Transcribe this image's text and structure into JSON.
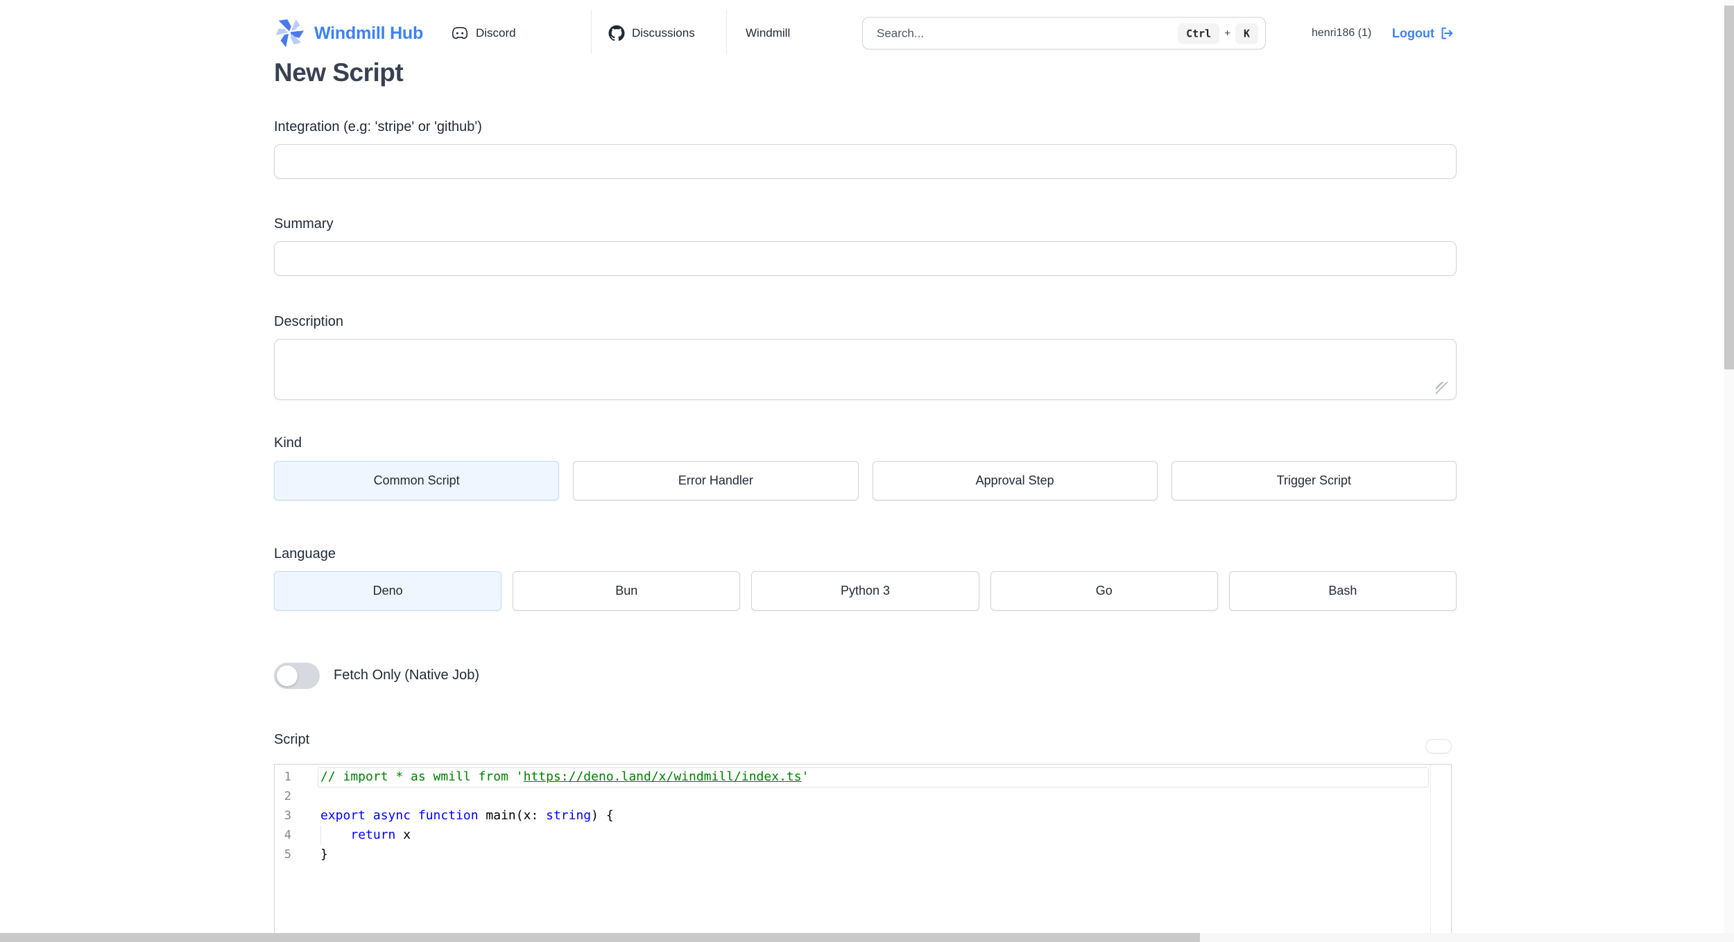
{
  "colors": {
    "accent": "#3b82f6",
    "selected_bg": "#eff6ff",
    "selected_border": "#bfdbfe",
    "code_keyword": "#0000ff",
    "code_comment": "#008000",
    "code_plain": "#000000"
  },
  "navbar": {
    "brand": "Windmill Hub",
    "discord_label": "Discord",
    "discussions_label": "Discussions",
    "windmill_label": "Windmill",
    "search_placeholder": "Search...",
    "kbd": {
      "ctrl": "Ctrl",
      "plus": "+",
      "k": "K"
    },
    "username": "henri186 (1)",
    "logout_label": "Logout"
  },
  "page": {
    "title": "New Script"
  },
  "form": {
    "integration_label": "Integration (e.g: 'stripe' or 'github')",
    "integration_value": "",
    "summary_label": "Summary",
    "summary_value": "",
    "description_label": "Description",
    "description_value": "",
    "kind_label": "Kind",
    "kind_options": [
      "Common Script",
      "Error Handler",
      "Approval Step",
      "Trigger Script"
    ],
    "kind_selected": "Common Script",
    "language_label": "Language",
    "language_options": [
      "Deno",
      "Bun",
      "Python 3",
      "Go",
      "Bash"
    ],
    "language_selected": "Deno",
    "fetch_only_label": "Fetch Only (Native Job)",
    "fetch_only_enabled": false,
    "script_label": "Script"
  },
  "editor": {
    "active_line": 1,
    "lines": [
      {
        "num": "1",
        "tokens": [
          {
            "c": "comment",
            "t": "// import * as wmill from '"
          },
          {
            "c": "comment_link",
            "t": "https://deno.land/x/windmill/index.ts"
          },
          {
            "c": "comment",
            "t": "'"
          }
        ]
      },
      {
        "num": "2",
        "tokens": []
      },
      {
        "num": "3",
        "tokens": [
          {
            "c": "keyword",
            "t": "export async function "
          },
          {
            "c": "plain",
            "t": "main(x: "
          },
          {
            "c": "keyword",
            "t": "string"
          },
          {
            "c": "plain",
            "t": ") {"
          }
        ]
      },
      {
        "num": "4",
        "indent_guide": true,
        "tokens": [
          {
            "c": "plain",
            "t": "    "
          },
          {
            "c": "keyword",
            "t": "return"
          },
          {
            "c": "plain",
            "t": " x"
          }
        ]
      },
      {
        "num": "5",
        "tokens": [
          {
            "c": "plain",
            "t": "}"
          }
        ]
      }
    ]
  }
}
